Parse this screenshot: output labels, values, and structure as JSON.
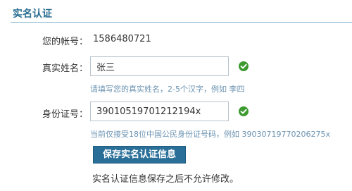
{
  "section": {
    "title": "实名认证"
  },
  "form": {
    "account": {
      "label": "您的帐号：",
      "value": "1586480721"
    },
    "real_name": {
      "label": "真实姓名：",
      "value": "张三",
      "valid_icon": "check-circle-icon",
      "hint": "请填写您的真实姓名，2-5个汉字，例如 李四"
    },
    "id_number": {
      "label": "身份证号：",
      "value": "39010519701212194x",
      "valid_icon": "check-circle-icon",
      "hint": "当前仅接受18位中国公民身份证号码，例如 39030719770206275x"
    },
    "submit_label": "保存实名认证信息",
    "note": "实名认证信息保存之后不允许修改。"
  },
  "colors": {
    "accent": "#2a6f98",
    "hint": "#6b93b2",
    "valid": "#3c9a2f"
  }
}
